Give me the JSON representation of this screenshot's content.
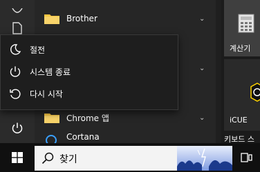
{
  "app_list": {
    "items": [
      {
        "label": "Brother",
        "has_folder": true,
        "expandable": true
      },
      {
        "label": "",
        "has_folder": false,
        "expandable": true
      },
      {
        "label": "Chrome 앱",
        "has_folder": true,
        "expandable": true
      },
      {
        "label": "Cortana",
        "has_folder": false,
        "expandable": false
      }
    ]
  },
  "power_menu": {
    "items": [
      {
        "label": "절전",
        "icon": "moon-icon"
      },
      {
        "label": "시스템 종료",
        "icon": "power-icon"
      },
      {
        "label": "다시 시작",
        "icon": "restart-icon"
      }
    ]
  },
  "tiles": {
    "calculator": "계산기",
    "icue": "iCUE",
    "keyboard": "키보드 스"
  },
  "taskbar": {
    "search_text": "찾기"
  },
  "colors": {
    "accent_blue": "#0078d7",
    "folder_yellow": "#f5c542"
  }
}
